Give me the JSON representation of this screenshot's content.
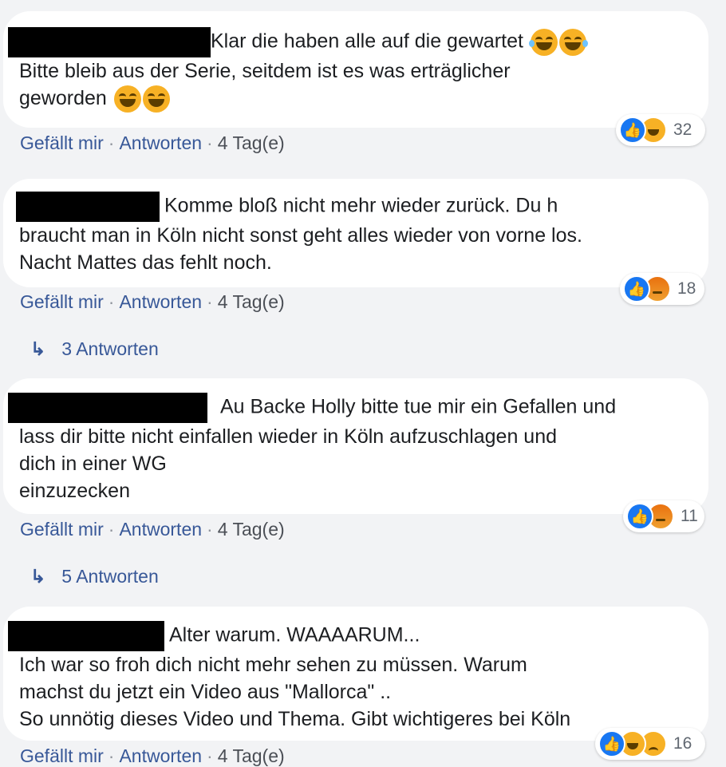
{
  "comments": [
    {
      "lines": [
        "Klar die haben alle auf die gewartet",
        "Bitte bleib aus der Serie, seitdem ist es was erträglicher",
        "geworden"
      ],
      "actions": {
        "like": "Gefällt mir",
        "reply": "Antworten",
        "time": "4 Tag(e)"
      },
      "reactions": {
        "icons": [
          "like-icon",
          "haha-icon"
        ],
        "count": "32"
      }
    },
    {
      "lines": [
        "Komme bloß nicht mehr wieder zurück. Du h",
        "braucht man in Köln nicht sonst geht alles wieder von vorne los.",
        "Nacht Mattes das fehlt noch."
      ],
      "actions": {
        "like": "Gefällt mir",
        "reply": "Antworten",
        "time": "4 Tag(e)"
      },
      "reactions": {
        "icons": [
          "like-icon",
          "angry-icon"
        ],
        "count": "18"
      },
      "replies": "3 Antworten"
    },
    {
      "lines": [
        "Au Backe Holly bitte tue mir ein Gefallen und",
        "lass dir bitte nicht einfallen wieder in Köln aufzuschlagen und",
        "dich in einer WG",
        "einzuzecken"
      ],
      "actions": {
        "like": "Gefällt mir",
        "reply": "Antworten",
        "time": "4 Tag(e)"
      },
      "reactions": {
        "icons": [
          "like-icon",
          "angry-icon"
        ],
        "count": "11"
      },
      "replies": "5 Antworten"
    },
    {
      "lines": [
        "Alter warum. WAAAARUM...",
        "Ich war so froh dich nicht mehr sehen zu müssen. Warum",
        "machst du jetzt ein Video aus \"Mallorca\" ..",
        "So unnötig dieses Video und Thema. Gibt wichtigeres bei Köln"
      ],
      "actions": {
        "like": "Gefällt mir",
        "reply": "Antworten",
        "time": "4 Tag(e)"
      },
      "reactions": {
        "icons": [
          "like-icon",
          "haha-icon",
          "sad-icon"
        ],
        "count": "16"
      }
    }
  ],
  "icons": {
    "reply_arrow": "↳",
    "emoji": "tears-of-joy-emoji"
  },
  "colors": {
    "link": "#385898",
    "like": "#1877f2",
    "bubble": "#ffffff",
    "background": "#f2f3f5"
  }
}
